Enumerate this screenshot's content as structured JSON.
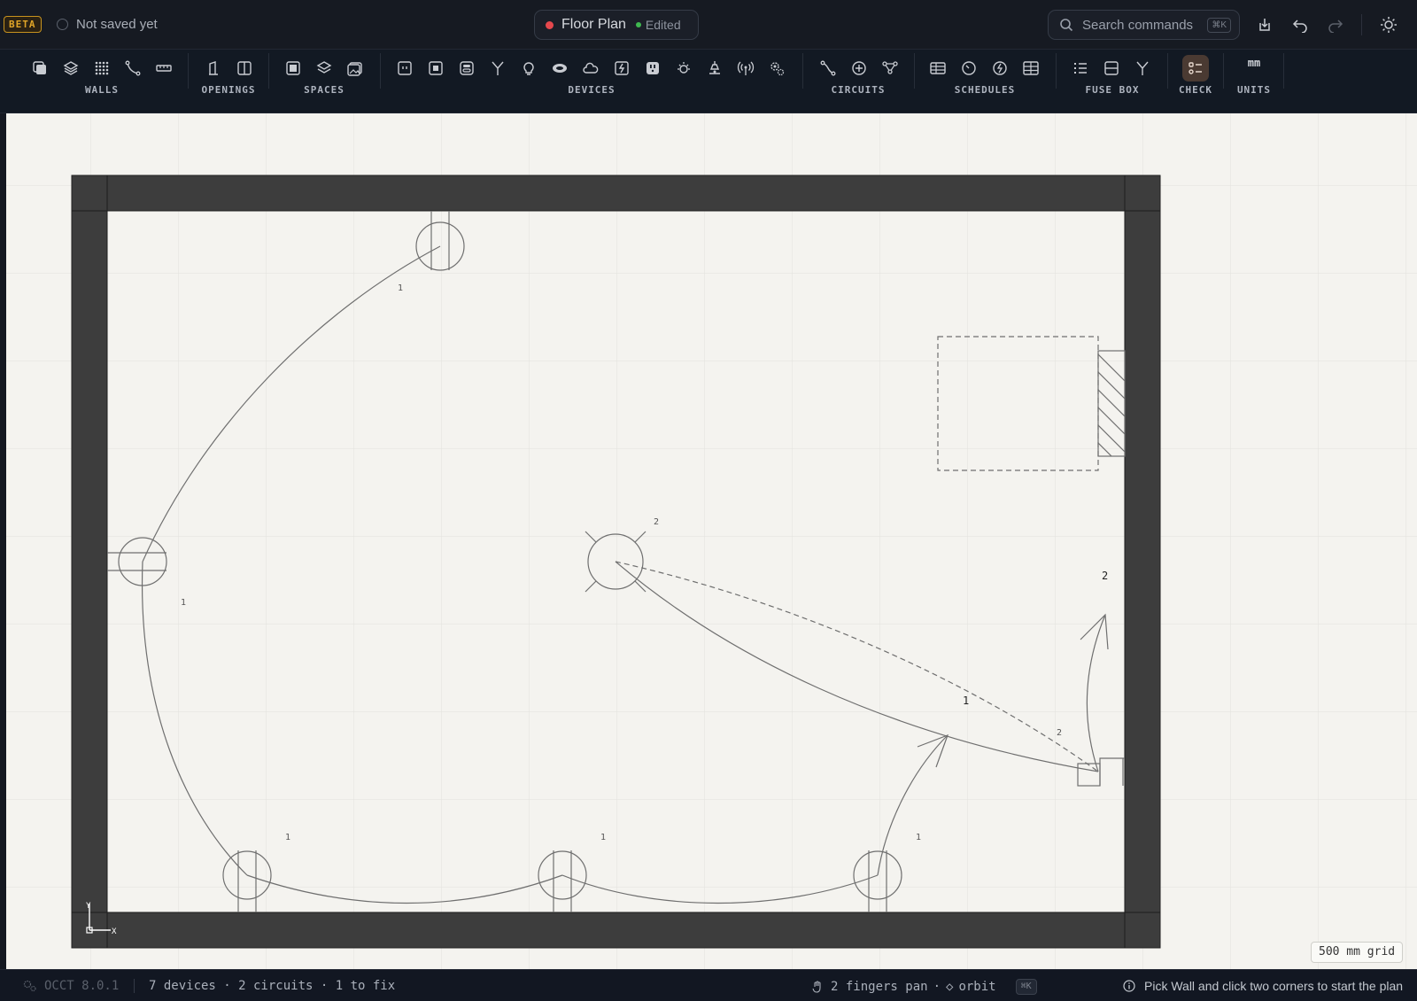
{
  "header": {
    "beta_badge": "BETA",
    "save_status": "Not saved yet",
    "document_title": "Floor Plan",
    "edit_status": "Edited",
    "search_placeholder": "Search commands",
    "search_shortcut": "⌘K",
    "icons": [
      "download-icon",
      "undo-icon",
      "redo-icon",
      "theme-sun-icon"
    ]
  },
  "toolbar": {
    "groups": [
      {
        "label": "WALLS",
        "tools": [
          "wall-copy-icon",
          "layers-icon",
          "grid-dots-icon",
          "curve-wall-icon",
          "measure-icon"
        ]
      },
      {
        "label": "OPENINGS",
        "tools": [
          "door-icon",
          "window-icon"
        ]
      },
      {
        "label": "SPACES",
        "tools": [
          "room-icon",
          "levels-icon",
          "image-icon"
        ]
      },
      {
        "label": "DEVICES",
        "tools": [
          "socket-icon",
          "double-socket-icon",
          "switch-icon",
          "branch-icon",
          "bulb-icon",
          "ceiling-light-icon",
          "cloud-icon",
          "power-icon",
          "outlet-icon",
          "sun-icon",
          "pendant-lamp-icon",
          "antenna-icon",
          "settings-gear-icon"
        ]
      },
      {
        "label": "CIRCUITS",
        "tools": [
          "wire-icon",
          "junction-icon",
          "network-icon"
        ]
      },
      {
        "label": "SCHEDULES",
        "tools": [
          "table-icon",
          "meter-icon",
          "lightning-icon",
          "grid-table-icon"
        ]
      },
      {
        "label": "FUSE BOX",
        "tools": [
          "list-icon",
          "panel-icon",
          "fork-icon"
        ]
      },
      {
        "label": "CHECK",
        "tools": [
          "checklist-icon"
        ],
        "active": true
      },
      {
        "label": "UNITS",
        "value": "mm"
      }
    ]
  },
  "plan": {
    "circuit_labels": [
      "1",
      "1",
      "1",
      "1",
      "1",
      "1",
      "2",
      "2",
      "2"
    ],
    "axis_x": "X",
    "axis_y": "Y"
  },
  "canvas": {
    "grid_badge": "500 mm grid"
  },
  "status": {
    "engine": "OCCT 8.0.1",
    "summary": "7 devices · 2 circuits · 1 to fix",
    "hint_pan": "2 fingers pan",
    "hint_orbit": "orbit",
    "hint_shortcut": "⌘K",
    "tip": "Pick Wall and click two corners to start the plan"
  },
  "colors": {
    "accent": "#e0a528",
    "recording": "#e5484d",
    "edited": "#3fb950",
    "active_tool": "#4a3a32",
    "wall": "#3d3d3d",
    "canvas": "#f4f3ef"
  }
}
